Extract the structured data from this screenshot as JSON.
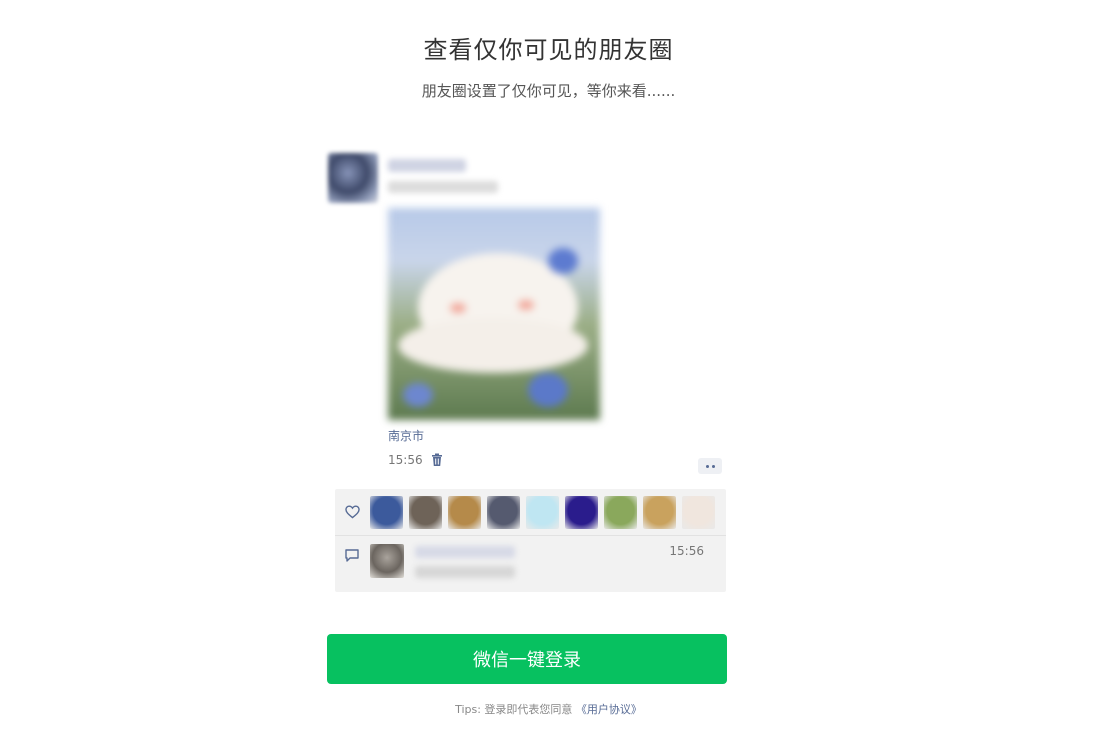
{
  "header": {
    "title": "查看仅你可见的朋友圈",
    "subtitle": "朋友圈设置了仅你可见，等你来看......"
  },
  "moment": {
    "location": "南京市",
    "time": "15:56"
  },
  "interactions": {
    "like_avatar_colors": [
      "#3c5a9c",
      "#6e6358",
      "#b58a4a",
      "#555a6f",
      "#bfe6f2",
      "#2a1c8c",
      "#8aa85c",
      "#c9a25e",
      "#f0e6de"
    ],
    "comment_time": "15:56"
  },
  "login": {
    "button_label": "微信一键登录",
    "tips_prefix": "Tips: 登录即代表您同意",
    "agreement_link": "《用户协议》"
  },
  "colors": {
    "accent_green": "#07c160",
    "link_blue": "#576b95"
  }
}
